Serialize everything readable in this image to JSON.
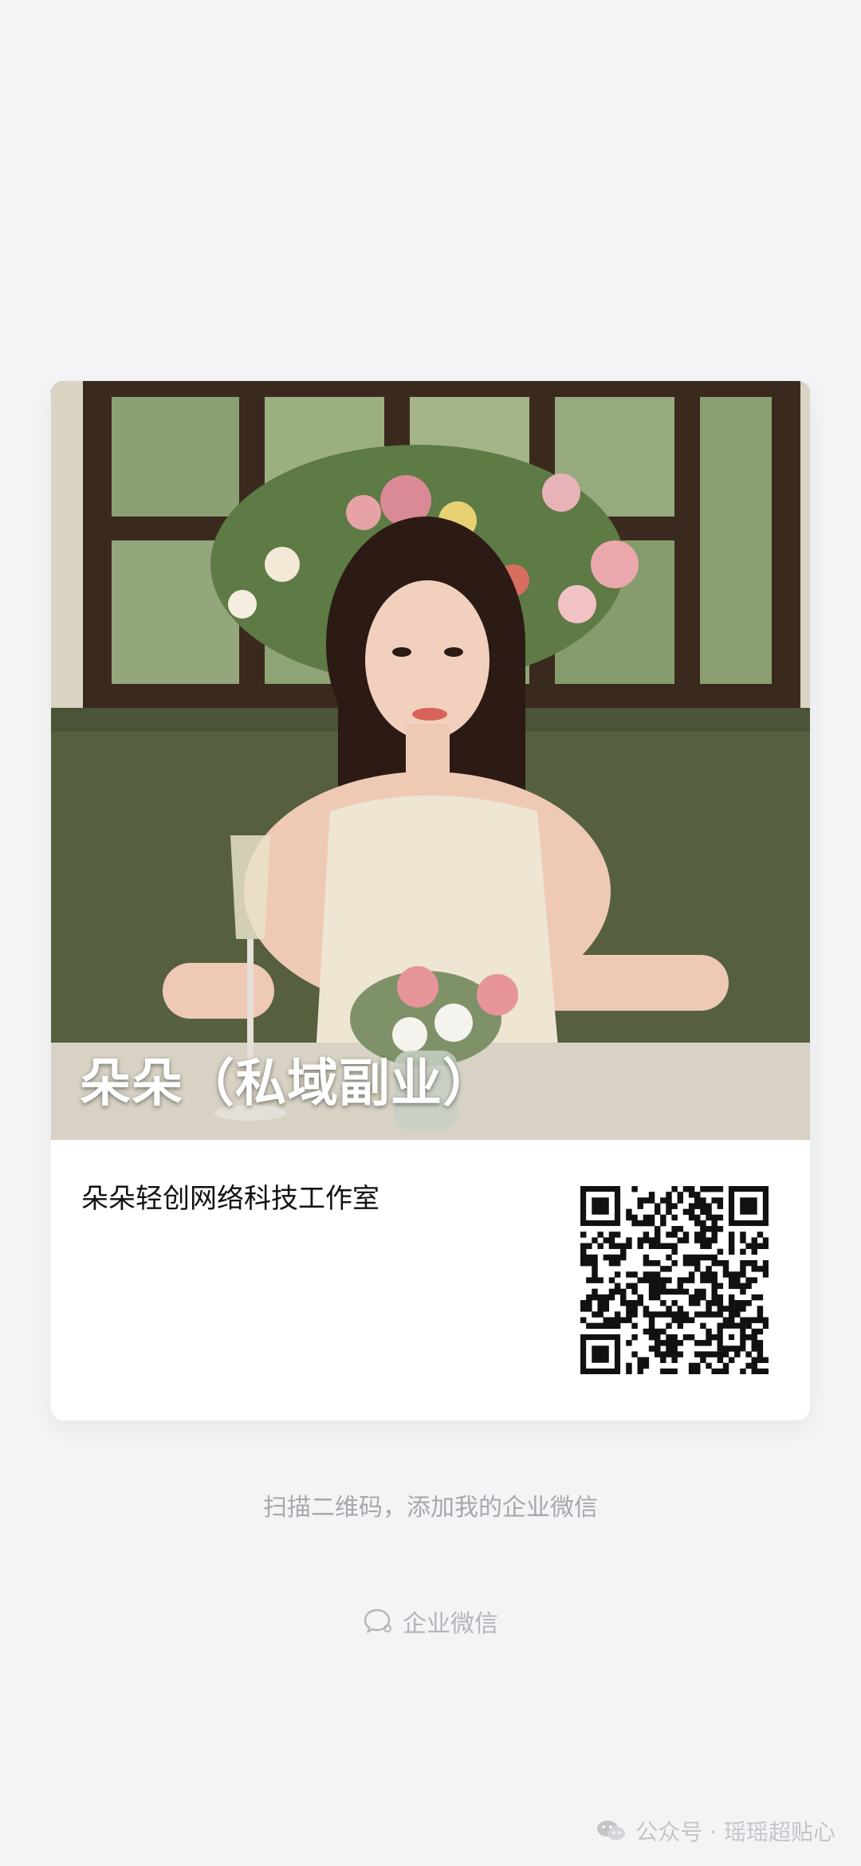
{
  "card": {
    "display_name": "朵朵（私域副业）",
    "company": "朵朵轻创网络科技工作室",
    "photo_icon": "profile-photo",
    "qr_icon": "qr-code"
  },
  "hint": "扫描二维码，添加我的企业微信",
  "brand": {
    "label": "企业微信",
    "icon": "wecom-chat-icon"
  },
  "watermark": {
    "text": "公众号 · 瑶瑶超贴心",
    "icon": "wechat-icon"
  }
}
